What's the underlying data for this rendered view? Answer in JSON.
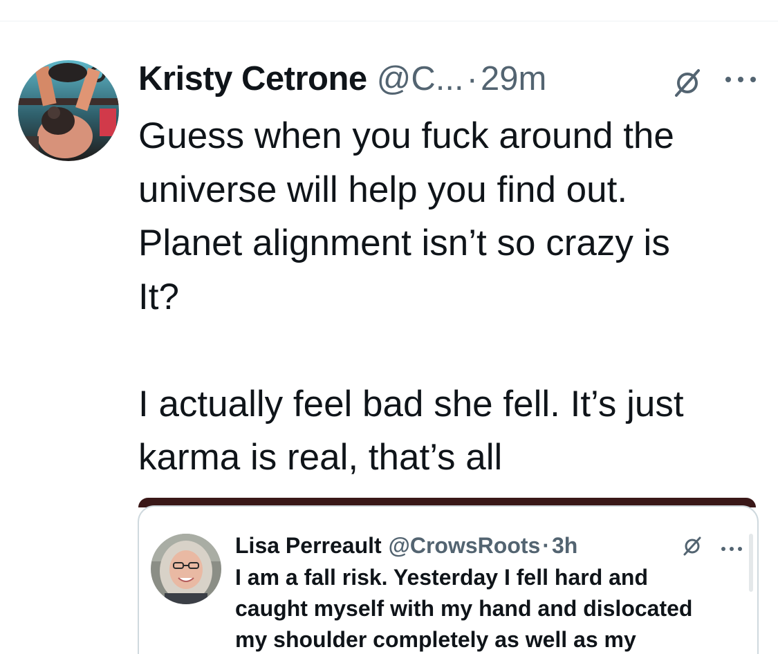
{
  "tweet": {
    "author_name": "Kristy Cetrone",
    "author_handle": "@C...",
    "separator": "·",
    "timestamp": "29m",
    "text": "Guess when you fuck around the\nuniverse will help you find out.\nPlanet alignment isn’t so crazy is\nIt?\n\nI actually feel bad she fell. It’s just\nkarma is real, that’s all"
  },
  "quoted_tweet": {
    "author_name": "Lisa Perreault",
    "author_handle": "@CrowsRoots",
    "separator": "·",
    "timestamp": "3h",
    "text": "I am a fall risk. Yesterday I fell hard and\ncaught myself with my hand and dislocated\nmy shoulder completely as well as my"
  },
  "icons": {
    "grok": "grok-icon",
    "more": "more-icon",
    "avatar": "avatar"
  },
  "colors": {
    "text_primary": "#0f1419",
    "text_secondary": "#536471",
    "border": "#cfd9de",
    "media_strip": "#3a1818"
  }
}
